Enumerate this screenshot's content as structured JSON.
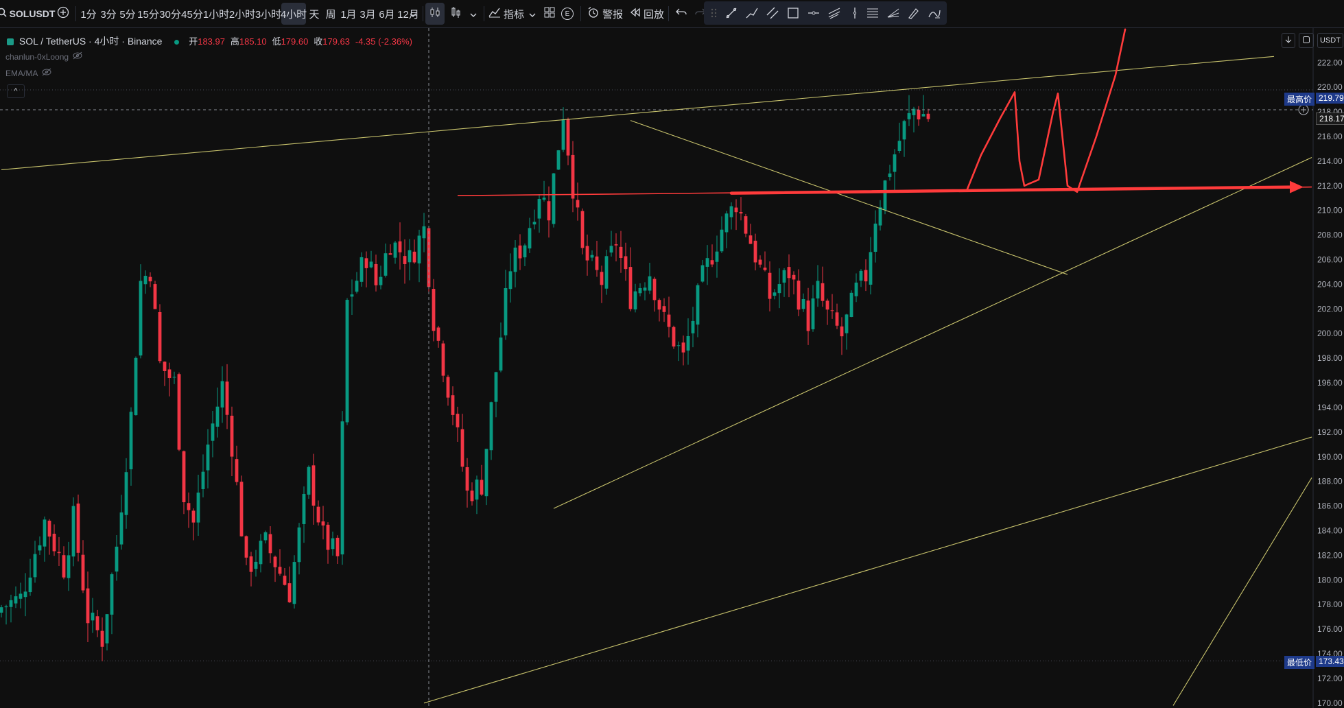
{
  "toolbar": {
    "symbol": "SOLUSDT",
    "intervals": [
      "1分",
      "3分",
      "5分",
      "15分",
      "30分",
      "45分",
      "1小时",
      "2小时",
      "3小时",
      "4小时",
      "天",
      "周",
      "1月",
      "3月",
      "6月",
      "12月"
    ],
    "active_interval": "4小时",
    "indicators_label": "指标",
    "e_badge": "E",
    "alert_label": "警报",
    "replay_label": "回放"
  },
  "legend": {
    "title": "SOL / TetherUS · 4小时 · Binance",
    "open_label": "开",
    "open": "183.97",
    "high_label": "高",
    "high": "185.10",
    "low_label": "低",
    "low": "179.60",
    "close_label": "收",
    "close": "179.63",
    "change": "-4.35 (-2.36%)",
    "indicator1": "chanlun-0xLoong",
    "indicator2": "EMA/MA",
    "collapse": "^"
  },
  "right_controls": {
    "currency": "USDT"
  },
  "tags": {
    "high_label": "最高价",
    "high_value": "219.79",
    "current_value": "218.17",
    "low_label": "最低价",
    "low_value": "173.43"
  },
  "colors": {
    "up": "#089981",
    "down": "#f23645",
    "trendline": "#c9c46d",
    "marker": "#ff3b3b",
    "background": "#0f0f0f"
  },
  "chart_data": {
    "type": "candlestick",
    "symbol": "SOL / TetherUS",
    "interval": "4小时",
    "exchange": "Binance",
    "y_axis_ticks": [
      222,
      220,
      218,
      216,
      214,
      212,
      210,
      208,
      206,
      204,
      202,
      200,
      198,
      196,
      194,
      192,
      190,
      188,
      186,
      184,
      182,
      180,
      178,
      176,
      174,
      172,
      170
    ],
    "ylim": [
      169.6,
      224.8
    ],
    "session_high": 219.79,
    "current_price": 218.17,
    "session_low": 173.43,
    "x_index_range": [
      0,
      275
    ],
    "trend_levels": [
      {
        "name": "upper-channel",
        "points": [
          [
            0,
            213.3
          ],
          [
            265,
            222.5
          ]
        ]
      },
      {
        "name": "descending-resistance",
        "points": [
          [
            131,
            217.3
          ],
          [
            222,
            204.8
          ]
        ]
      },
      {
        "name": "ascending-support",
        "points": [
          [
            115,
            185.8
          ],
          [
            275,
            214.3
          ]
        ]
      },
      {
        "name": "lower-channel",
        "points": [
          [
            88,
            170.0
          ],
          [
            275,
            191.6
          ]
        ]
      },
      {
        "name": "steep-line",
        "points": [
          [
            244,
            169.8
          ],
          [
            275,
            188.3
          ]
        ]
      },
      {
        "name": "horizontal-level",
        "points": [
          [
            95,
            211.2
          ],
          [
            275,
            211.9
          ]
        ]
      }
    ],
    "crosshair_x_index": 89,
    "projection_path": [
      [
        201,
        211.6
      ],
      [
        204,
        214.5
      ],
      [
        208,
        217.5
      ],
      [
        211,
        219.6
      ],
      [
        212,
        214.0
      ],
      [
        213,
        212.0
      ],
      [
        216,
        212.5
      ],
      [
        219,
        218.0
      ],
      [
        220,
        219.5
      ],
      [
        222,
        212.0
      ],
      [
        224,
        211.5
      ],
      [
        228,
        216.0
      ],
      [
        232,
        221.0
      ],
      [
        234,
        224.7
      ]
    ],
    "candles": []
  }
}
